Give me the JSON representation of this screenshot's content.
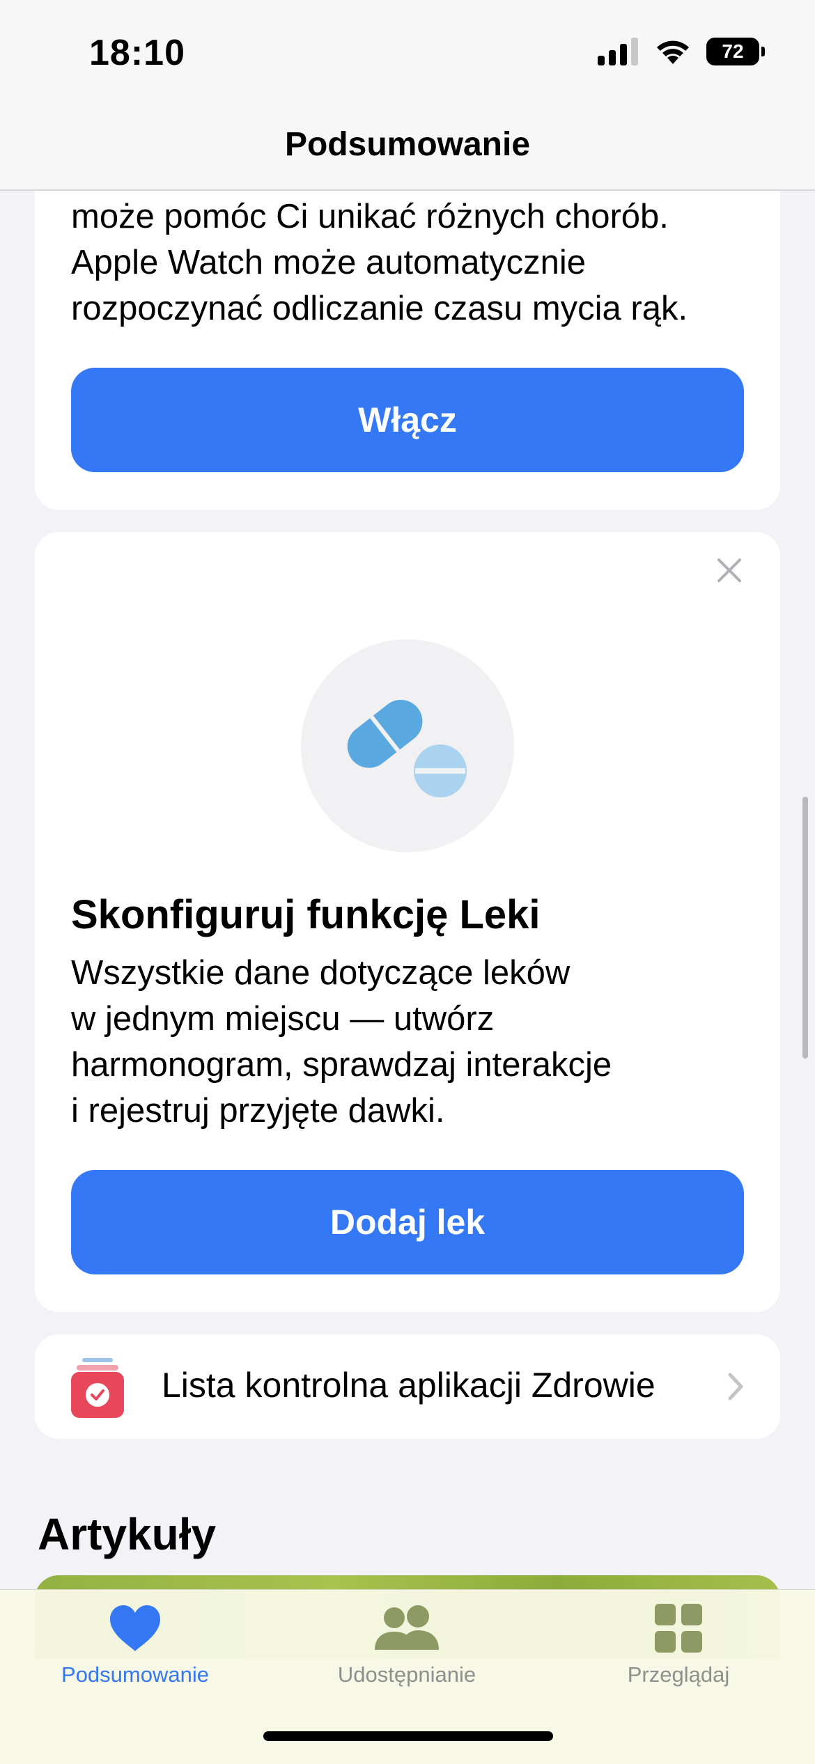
{
  "status_bar": {
    "time": "18:10",
    "battery": "72"
  },
  "nav": {
    "title": "Podsumowanie"
  },
  "handwashing_card": {
    "text_lines": [
      "może pomóc Ci unikać różnych chorób.",
      "Apple Watch może automatycznie",
      "rozpoczynać odliczanie czasu mycia rąk."
    ],
    "button_label": "Włącz"
  },
  "medications_card": {
    "title": "Skonfiguruj funkcję Leki",
    "text_lines": [
      "Wszystkie dane dotyczące leków",
      "w jednym miejscu — utwórz",
      "harmonogram, sprawdzaj interakcje",
      "i rejestruj przyjęte dawki."
    ],
    "button_label": "Dodaj lek"
  },
  "checklist_row": {
    "label": "Lista kontrolna aplikacji Zdrowie"
  },
  "articles": {
    "title": "Artykuły"
  },
  "tabbar": {
    "tabs": [
      {
        "label": "Podsumowanie",
        "icon": "heart-icon",
        "selected": true
      },
      {
        "label": "Udostępnianie",
        "icon": "people-icon",
        "selected": false
      },
      {
        "label": "Przeglądaj",
        "icon": "grid-icon",
        "selected": false
      }
    ]
  },
  "colors": {
    "accent": "#3478f6",
    "pill": "#5aa8e0",
    "checklist_icon": "#e8475b"
  }
}
